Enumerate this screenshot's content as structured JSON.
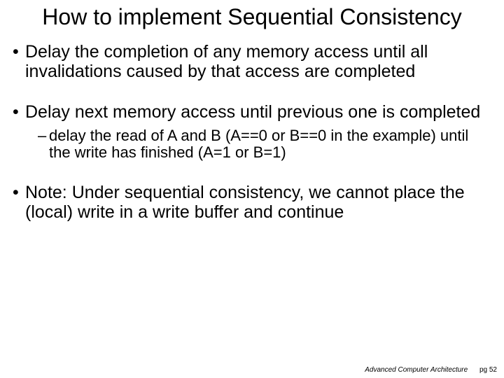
{
  "title": "How to implement Sequential Consistency",
  "bullets": {
    "b1": "Delay the completion of any memory access until all invalidations caused by that access are completed",
    "b2": "Delay next memory access until previous one is completed",
    "b2_sub": "delay the read of A and B (A==0 or B==0 in the example) until the write has finished (A=1 or B=1)",
    "b3": "Note: Under sequential consistency, we cannot place the (local) write in a write buffer and continue"
  },
  "footer": {
    "course": "Advanced Computer Architecture",
    "page": "pg 52"
  }
}
